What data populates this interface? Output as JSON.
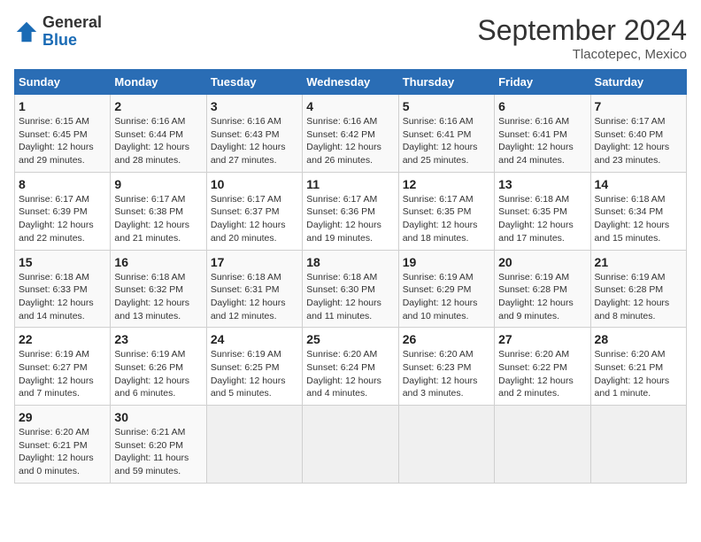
{
  "header": {
    "logo_general": "General",
    "logo_blue": "Blue",
    "month_title": "September 2024",
    "location": "Tlacotepec, Mexico"
  },
  "weekdays": [
    "Sunday",
    "Monday",
    "Tuesday",
    "Wednesday",
    "Thursday",
    "Friday",
    "Saturday"
  ],
  "weeks": [
    [
      {
        "day": "1",
        "sunrise": "6:15 AM",
        "sunset": "6:45 PM",
        "daylight": "12 hours and 29 minutes."
      },
      {
        "day": "2",
        "sunrise": "6:16 AM",
        "sunset": "6:44 PM",
        "daylight": "12 hours and 28 minutes."
      },
      {
        "day": "3",
        "sunrise": "6:16 AM",
        "sunset": "6:43 PM",
        "daylight": "12 hours and 27 minutes."
      },
      {
        "day": "4",
        "sunrise": "6:16 AM",
        "sunset": "6:42 PM",
        "daylight": "12 hours and 26 minutes."
      },
      {
        "day": "5",
        "sunrise": "6:16 AM",
        "sunset": "6:41 PM",
        "daylight": "12 hours and 25 minutes."
      },
      {
        "day": "6",
        "sunrise": "6:16 AM",
        "sunset": "6:41 PM",
        "daylight": "12 hours and 24 minutes."
      },
      {
        "day": "7",
        "sunrise": "6:17 AM",
        "sunset": "6:40 PM",
        "daylight": "12 hours and 23 minutes."
      }
    ],
    [
      {
        "day": "8",
        "sunrise": "6:17 AM",
        "sunset": "6:39 PM",
        "daylight": "12 hours and 22 minutes."
      },
      {
        "day": "9",
        "sunrise": "6:17 AM",
        "sunset": "6:38 PM",
        "daylight": "12 hours and 21 minutes."
      },
      {
        "day": "10",
        "sunrise": "6:17 AM",
        "sunset": "6:37 PM",
        "daylight": "12 hours and 20 minutes."
      },
      {
        "day": "11",
        "sunrise": "6:17 AM",
        "sunset": "6:36 PM",
        "daylight": "12 hours and 19 minutes."
      },
      {
        "day": "12",
        "sunrise": "6:17 AM",
        "sunset": "6:35 PM",
        "daylight": "12 hours and 18 minutes."
      },
      {
        "day": "13",
        "sunrise": "6:18 AM",
        "sunset": "6:35 PM",
        "daylight": "12 hours and 17 minutes."
      },
      {
        "day": "14",
        "sunrise": "6:18 AM",
        "sunset": "6:34 PM",
        "daylight": "12 hours and 15 minutes."
      }
    ],
    [
      {
        "day": "15",
        "sunrise": "6:18 AM",
        "sunset": "6:33 PM",
        "daylight": "12 hours and 14 minutes."
      },
      {
        "day": "16",
        "sunrise": "6:18 AM",
        "sunset": "6:32 PM",
        "daylight": "12 hours and 13 minutes."
      },
      {
        "day": "17",
        "sunrise": "6:18 AM",
        "sunset": "6:31 PM",
        "daylight": "12 hours and 12 minutes."
      },
      {
        "day": "18",
        "sunrise": "6:18 AM",
        "sunset": "6:30 PM",
        "daylight": "12 hours and 11 minutes."
      },
      {
        "day": "19",
        "sunrise": "6:19 AM",
        "sunset": "6:29 PM",
        "daylight": "12 hours and 10 minutes."
      },
      {
        "day": "20",
        "sunrise": "6:19 AM",
        "sunset": "6:28 PM",
        "daylight": "12 hours and 9 minutes."
      },
      {
        "day": "21",
        "sunrise": "6:19 AM",
        "sunset": "6:28 PM",
        "daylight": "12 hours and 8 minutes."
      }
    ],
    [
      {
        "day": "22",
        "sunrise": "6:19 AM",
        "sunset": "6:27 PM",
        "daylight": "12 hours and 7 minutes."
      },
      {
        "day": "23",
        "sunrise": "6:19 AM",
        "sunset": "6:26 PM",
        "daylight": "12 hours and 6 minutes."
      },
      {
        "day": "24",
        "sunrise": "6:19 AM",
        "sunset": "6:25 PM",
        "daylight": "12 hours and 5 minutes."
      },
      {
        "day": "25",
        "sunrise": "6:20 AM",
        "sunset": "6:24 PM",
        "daylight": "12 hours and 4 minutes."
      },
      {
        "day": "26",
        "sunrise": "6:20 AM",
        "sunset": "6:23 PM",
        "daylight": "12 hours and 3 minutes."
      },
      {
        "day": "27",
        "sunrise": "6:20 AM",
        "sunset": "6:22 PM",
        "daylight": "12 hours and 2 minutes."
      },
      {
        "day": "28",
        "sunrise": "6:20 AM",
        "sunset": "6:21 PM",
        "daylight": "12 hours and 1 minute."
      }
    ],
    [
      {
        "day": "29",
        "sunrise": "6:20 AM",
        "sunset": "6:21 PM",
        "daylight": "12 hours and 0 minutes."
      },
      {
        "day": "30",
        "sunrise": "6:21 AM",
        "sunset": "6:20 PM",
        "daylight": "11 hours and 59 minutes."
      },
      null,
      null,
      null,
      null,
      null
    ]
  ]
}
